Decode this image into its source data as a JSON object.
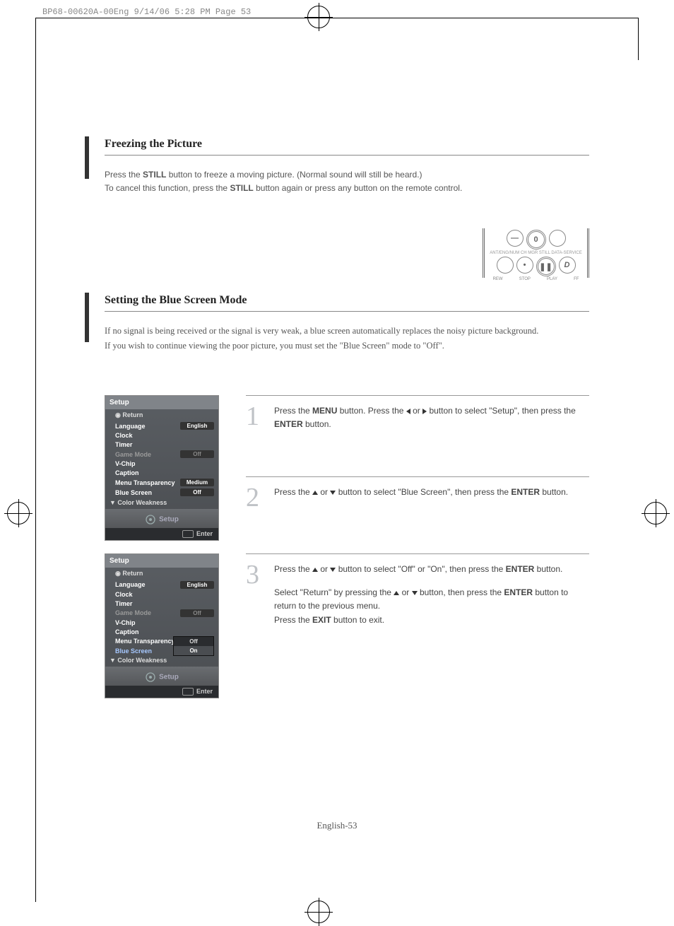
{
  "header_info": "BP68-00620A-00Eng  9/14/06  5:28 PM  Page 53",
  "section1": {
    "title": "Freezing the Picture",
    "para1_pre": "Press the ",
    "para1_bold": "STILL",
    "para1_post": " button to freeze a moving picture. (Normal sound will still be heard.)",
    "para2_pre": "To cancel this function, press the ",
    "para2_bold": "STILL",
    "para2_post": " button again or press any button on the remote control."
  },
  "remote": {
    "top_label_right": "",
    "big_btn": "0",
    "row2_labels": "ANT/ENG/NUM CH MGR   STILL   DATA-SERVICE",
    "row3_icons": [
      "",
      "•",
      "❚❚",
      "D"
    ],
    "bottom_labels": [
      "REW",
      "STOP",
      "PLAY",
      "FF"
    ]
  },
  "section2": {
    "title": "Setting the Blue Screen Mode",
    "intro1": "If no signal is being received or the signal is very weak, a blue screen automatically replaces  the noisy picture background.",
    "intro2": "If you wish to continue viewing the poor picture, you must set the \"Blue Screen\" mode to \"Off\"."
  },
  "osd": {
    "title": "Setup",
    "return": "Return",
    "rows": [
      {
        "label": "Language",
        "value": "English"
      },
      {
        "label": "Clock",
        "value": ""
      },
      {
        "label": "Timer",
        "value": ""
      },
      {
        "label": "Game Mode",
        "value": "Off",
        "dim": true
      },
      {
        "label": "V-Chip",
        "value": ""
      },
      {
        "label": "Caption",
        "value": ""
      },
      {
        "label": "Menu Transparency",
        "value": "Medium"
      },
      {
        "label": "Blue Screen",
        "value": "Off"
      }
    ],
    "more": "▼ Color Weakness",
    "footer_label": "Setup",
    "enter": "Enter",
    "popup": {
      "off": "Off",
      "on": "On"
    }
  },
  "steps": {
    "s1": {
      "num": "1",
      "t1": "Press the ",
      "b1": "MENU",
      "t2": " button. Press the ",
      "t3": " or ",
      "t4": " button to select \"Setup\", then press the ",
      "b2": "ENTER",
      "t5": " button."
    },
    "s2": {
      "num": "2",
      "t1": "Press the ",
      "t2": " or ",
      "t3": " button to select \"Blue Screen\", then press the ",
      "b1": "ENTER",
      "t4": " button."
    },
    "s3": {
      "num": "3",
      "t1": "Press the ",
      "t2": " or ",
      "t3": " button to select \"Off\" or \"On\", then press the ",
      "b1": "ENTER",
      "t4": " button.",
      "p2_t1": "Select \"Return\" by pressing the ",
      "p2_t2": " or ",
      "p2_t3": " button, then press the ",
      "p2_b1": "ENTER",
      "p2_t4": " button to return to the previous menu.",
      "p3_t1": "Press the ",
      "p3_b1": "EXIT",
      "p3_t2": " button to exit."
    }
  },
  "page_num": "English-53"
}
